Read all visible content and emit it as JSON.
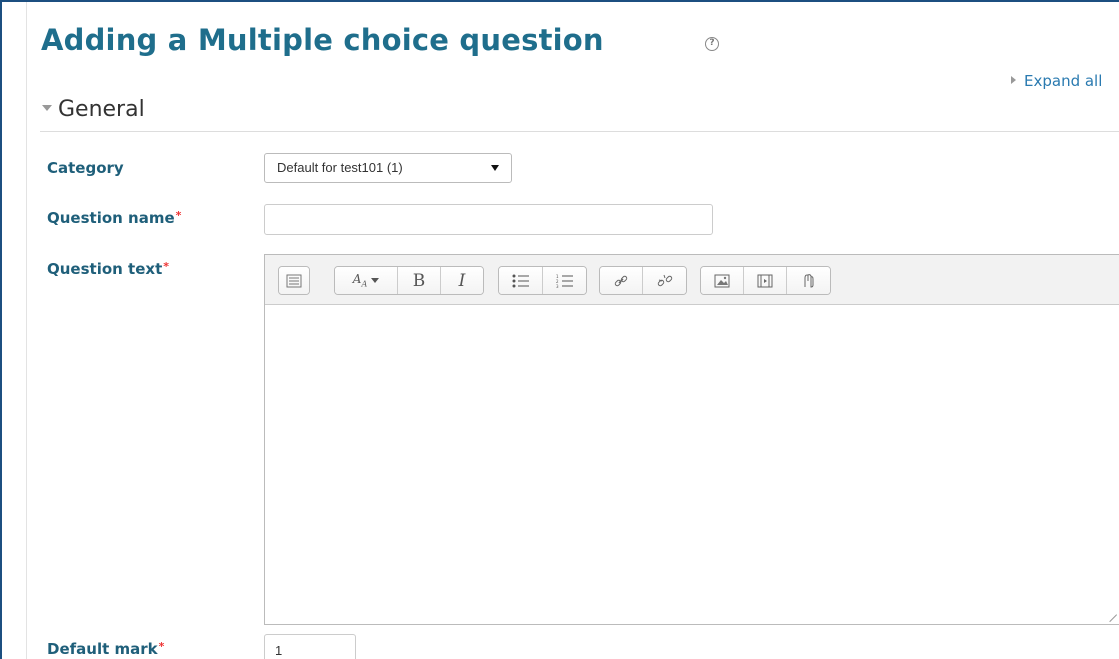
{
  "page": {
    "title": "Adding a Multiple choice question",
    "expand_all": "Expand all"
  },
  "section": {
    "title": "General"
  },
  "form": {
    "category": {
      "label": "Category",
      "selected": "Default for test101 (1)"
    },
    "question_name": {
      "label": "Question name",
      "value": ""
    },
    "question_text": {
      "label": "Question text",
      "toolbar": [
        [
          "toolbar-toggle-icon"
        ],
        [
          "font-style-icon",
          "bold-icon",
          "italic-icon"
        ],
        [
          "unordered-list-icon",
          "ordered-list-icon"
        ],
        [
          "link-icon",
          "unlink-icon"
        ],
        [
          "image-icon",
          "media-icon",
          "manage-files-icon"
        ]
      ]
    },
    "default_mark": {
      "label": "Default mark",
      "value": "1"
    },
    "required_marker": "*"
  },
  "colors": {
    "title": "#1f6e8c",
    "label": "#1f5f7a",
    "link": "#2a7ab0",
    "required": "#ee3333",
    "frame": "#1c4f80"
  }
}
